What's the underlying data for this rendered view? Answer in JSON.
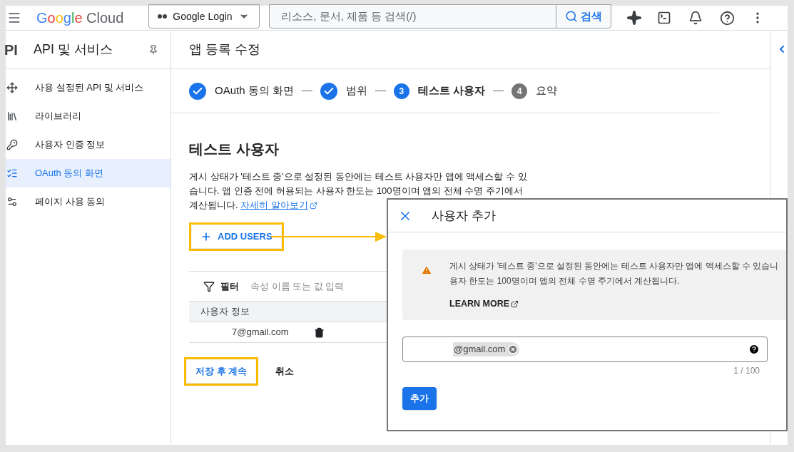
{
  "top_bar": {
    "logo": "Google Cloud",
    "project": "Google Login",
    "search": {
      "placeholder": "리소스, 문서, 제품 등 검색(/)",
      "button": "검색"
    }
  },
  "sidebar": {
    "badge": "PI",
    "title": "API 및 서비스",
    "items": [
      {
        "label": "사용 설정된 API 및 서비스",
        "selected": false
      },
      {
        "label": "라이브러리",
        "selected": false
      },
      {
        "label": "사용자 인증 정보",
        "selected": false
      },
      {
        "label": "OAuth 동의 화면",
        "selected": true
      },
      {
        "label": "페이지 사용 동의",
        "selected": false
      }
    ]
  },
  "page": {
    "title": "앱 등록 수정",
    "steps": [
      {
        "label": "OAuth 동의 화면",
        "kind": "done"
      },
      {
        "label": "범위",
        "kind": "done"
      },
      {
        "number": "3",
        "label": "테스트 사용자",
        "kind": "current"
      },
      {
        "number": "4",
        "label": "요약",
        "kind": "pending"
      }
    ],
    "section_title": "테스트 사용자",
    "description_lines": [
      "게시 상태가 '테스트 중'으로 설정된 동안에는 테스트 사용자만 앱에 액세스할 수 있",
      "습니다. 앱 인증 전에 허용되는 사용자 한도는 100명이며 앱의 전체 수명 주기에서",
      "계산됩니다."
    ],
    "learn_link": "자세히 알아보기",
    "add_users": "ADD USERS",
    "filter": {
      "label": "필터",
      "placeholder": "속성 이름 또는 값 입력"
    },
    "table": {
      "columns": [
        "사용자 정보"
      ],
      "rows": [
        {
          "email": "7@gmail.com"
        }
      ]
    },
    "save": "저장 후 계속",
    "cancel": "취소"
  },
  "dialog": {
    "title": "사용자 추가",
    "notice_lines": [
      "게시 상태가 '테스트 중'으로 설정된 동안에는 테스트 사용자만 앱에 액세스할 수 있습니",
      "용자 한도는 100명이며 앱의 전체 수명 주기에서 계산됩니다."
    ],
    "learn_more": "LEARN MORE",
    "chips": [
      "@gmail.com"
    ],
    "counter": "1 / 100",
    "submit": "추가"
  }
}
